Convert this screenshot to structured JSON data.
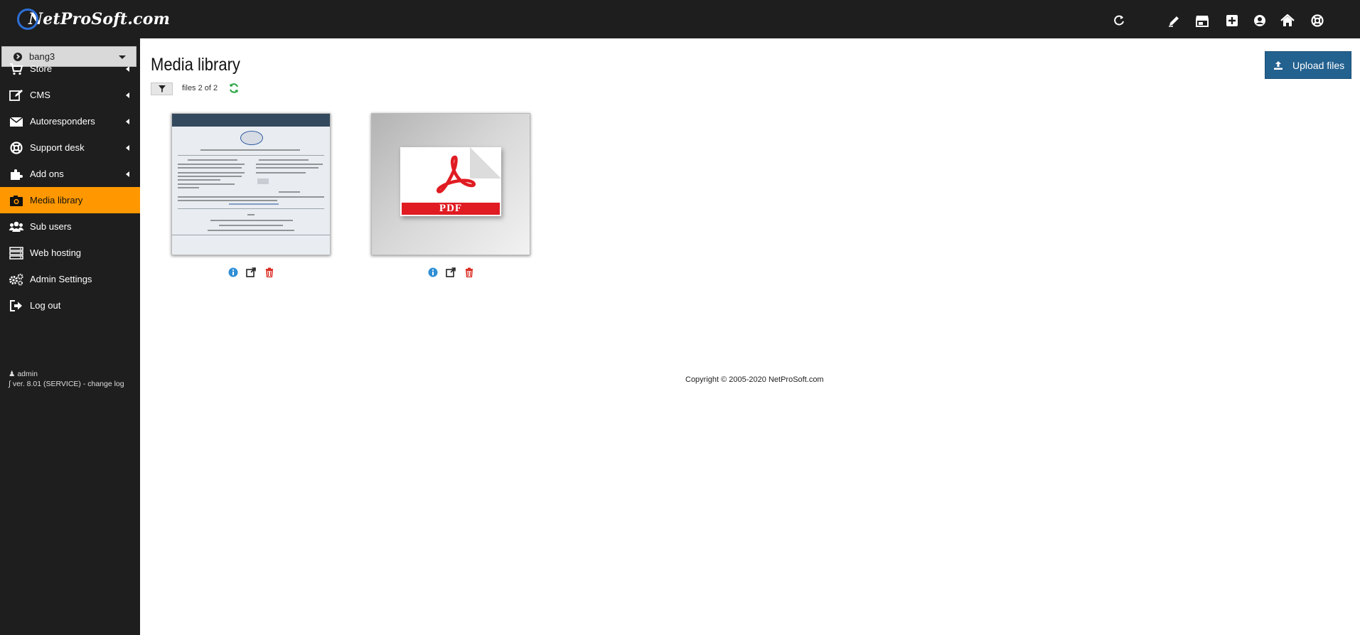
{
  "app": {
    "brand_text": "NetProSoft.com",
    "accent_color": "#ff9800",
    "topbar_color": "#1e1e1e",
    "primary_button_color": "#23618f"
  },
  "topbar": {
    "icons": [
      "refresh-icon",
      "pencil-icon",
      "store-icon",
      "plus-square-icon",
      "user-circle-icon",
      "home-icon",
      "lifesaver-icon"
    ]
  },
  "sidebar": {
    "site_select": "bang3",
    "items": [
      {
        "label": "Store",
        "icon": "cart-icon",
        "submenu": true
      },
      {
        "label": "CMS",
        "icon": "edit-icon",
        "submenu": true
      },
      {
        "label": "Autoresponders",
        "icon": "envelope-icon",
        "submenu": true
      },
      {
        "label": "Support desk",
        "icon": "lifesaver-icon",
        "submenu": true
      },
      {
        "label": "Add ons",
        "icon": "puzzle-icon",
        "submenu": true
      },
      {
        "label": "Media library",
        "icon": "camera-icon",
        "active": true
      },
      {
        "label": "Sub users",
        "icon": "users-icon"
      },
      {
        "label": "Web hosting",
        "icon": "server-icon"
      },
      {
        "label": "Admin Settings",
        "icon": "cogs-icon"
      },
      {
        "label": "Log out",
        "icon": "signout-icon"
      }
    ],
    "footer_user": "admin",
    "footer_version": "ver. 8.01 (SERVICE) - change log"
  },
  "main": {
    "title": "Media library",
    "files_count": "files 2 of 2",
    "upload_label": "Upload files",
    "files": [
      {
        "kind": "image",
        "preview": "document-screenshot"
      },
      {
        "kind": "pdf",
        "badge": "PDF"
      }
    ],
    "file_actions": [
      "info-icon",
      "external-link-icon",
      "trash-icon"
    ]
  },
  "footer": {
    "copyright": "Copyright © 2005-2020 NetProSoft.com"
  }
}
